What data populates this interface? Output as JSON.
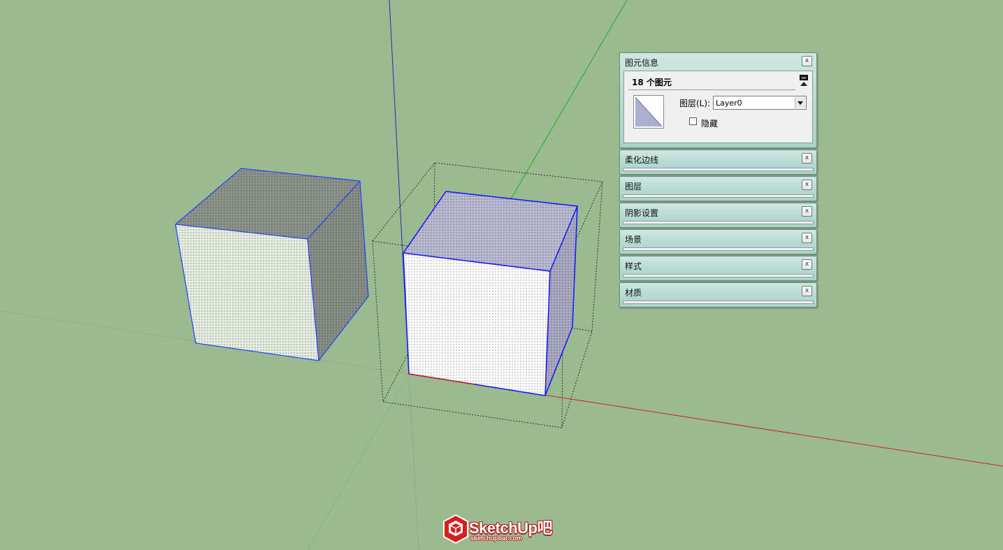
{
  "entity_info": {
    "title": "图元信息",
    "close_glyph": "x",
    "count_label": "18 个图元",
    "layer_label": "图层(L):",
    "layer_value": "Layer0",
    "hide_label": "隐藏",
    "hide_checked": false
  },
  "trays": [
    {
      "title": "柔化边线",
      "close_glyph": "x"
    },
    {
      "title": "图层",
      "close_glyph": "x"
    },
    {
      "title": "阴影设置",
      "close_glyph": "x"
    },
    {
      "title": "场景",
      "close_glyph": "x"
    },
    {
      "title": "样式",
      "close_glyph": "x"
    },
    {
      "title": "材质",
      "close_glyph": "x"
    }
  ],
  "watermark": {
    "brand": "SketchUp吧",
    "url": "sketchupbar.com"
  },
  "colors": {
    "background": "#99bb8f",
    "selection_edge": "#1a1aff",
    "axis_red": "#cc2222",
    "axis_green": "#2aa82a",
    "axis_blue": "#2a2ab0",
    "panel_header": "#b7dbd2",
    "brand_red": "#d42020"
  },
  "icons": {
    "close": "close-icon",
    "collapse": "collapse-icon",
    "dropdown": "chevron-down-icon",
    "material_swatch": "material-swatch-icon",
    "logo": "sketchup-logo-icon"
  }
}
